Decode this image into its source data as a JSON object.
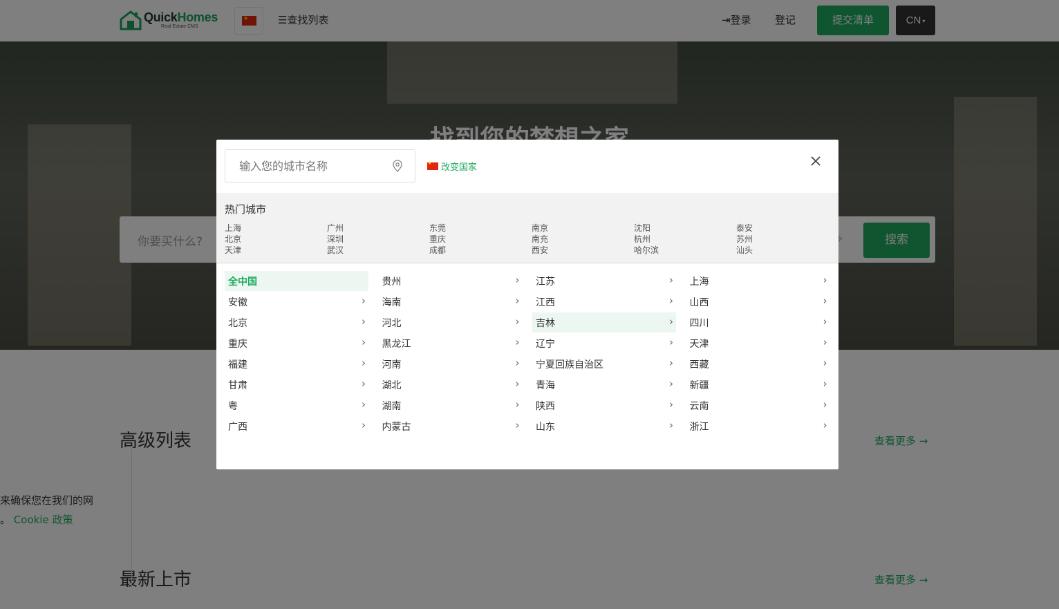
{
  "navbar": {
    "logo_main": "Quick",
    "logo_accent": "Homes",
    "logo_sub": "Real Estate CMS",
    "find_listings": "☰查找列表",
    "login": "⇥登录",
    "register": "登记",
    "submit_listing": "提交清单",
    "language": "CN"
  },
  "hero": {
    "title": "找到您的梦想之家",
    "search_placeholder": "你要买什么?",
    "search_button": "搜索"
  },
  "sections": {
    "premium_title": "高级列表",
    "latest_title": "最新上市",
    "view_more": "查看更多 →"
  },
  "cookie": {
    "line1": "来确保您在我们的网",
    "line2_prefix": "。",
    "policy_link": "Cookie 政策"
  },
  "modal": {
    "city_placeholder": "输入您的城市名称",
    "change_country": "改变国家",
    "hot_cities_title": "热门城市",
    "hot_cities": [
      [
        "上海",
        "北京",
        "天津"
      ],
      [
        "广州",
        "深圳",
        "武汉"
      ],
      [
        "东莞",
        "重庆",
        "成都"
      ],
      [
        "南京",
        "南充",
        "西安"
      ],
      [
        "沈阳",
        "杭州",
        "哈尔滨"
      ],
      [
        "泰安",
        "苏州",
        "汕头"
      ]
    ],
    "provinces": [
      [
        "全中国",
        "安徽",
        "北京",
        "重庆",
        "福建",
        "甘肃",
        "粤",
        "广西"
      ],
      [
        "贵州",
        "海南",
        "河北",
        "黑龙江",
        "河南",
        "湖北",
        "湖南",
        "内蒙古"
      ],
      [
        "江苏",
        "江西",
        "吉林",
        "辽宁",
        "宁夏回族自治区",
        "青海",
        "陕西",
        "山东"
      ],
      [
        "上海",
        "山西",
        "四川",
        "天津",
        "西藏",
        "新疆",
        "云南",
        "浙江"
      ]
    ],
    "active_province": "全中国",
    "hovered_province": "吉林"
  },
  "colors": {
    "accent": "#1eaa5e",
    "dark": "#333333"
  }
}
